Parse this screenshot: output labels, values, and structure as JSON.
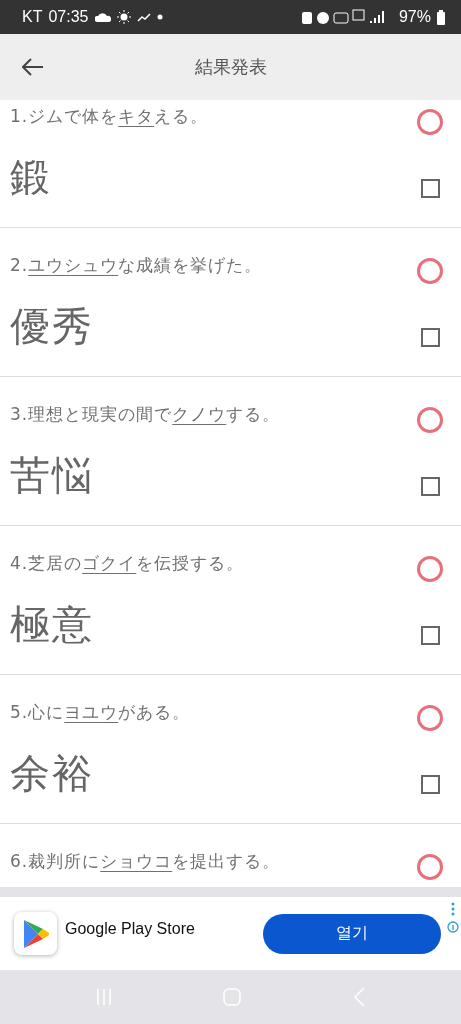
{
  "status_bar": {
    "carrier": "KT",
    "time": "07:35",
    "battery": "97%"
  },
  "app_bar": {
    "title": "結果発表"
  },
  "questions": [
    {
      "number": "1.",
      "before": "ジムで体を",
      "underlined": "キタ",
      "after": "える。",
      "answer": "鍛",
      "correct": true,
      "checked": false
    },
    {
      "number": "2.",
      "underlined": "ユウシュウ",
      "after": "な成績を挙げた。",
      "answer": "優秀",
      "correct": true,
      "checked": false
    },
    {
      "number": "3.",
      "before": "理想と現実の間で",
      "underlined": "クノウ",
      "after": "する。",
      "answer": "苦悩",
      "correct": true,
      "checked": false
    },
    {
      "number": "4.",
      "before": "芝居の",
      "underlined": "ゴクイ",
      "after": "を伝授する。",
      "answer": "極意",
      "correct": true,
      "checked": false
    },
    {
      "number": "5.",
      "before": "心に",
      "underlined": "ヨユウ",
      "after": "がある。",
      "answer": "余裕",
      "correct": true,
      "checked": false
    },
    {
      "number": "6.",
      "before": "裁判所に",
      "underlined": "ショウコ",
      "after": "を提出する。",
      "correct": true
    }
  ],
  "ad": {
    "app_name": "Google Play Store",
    "button": "열기"
  }
}
